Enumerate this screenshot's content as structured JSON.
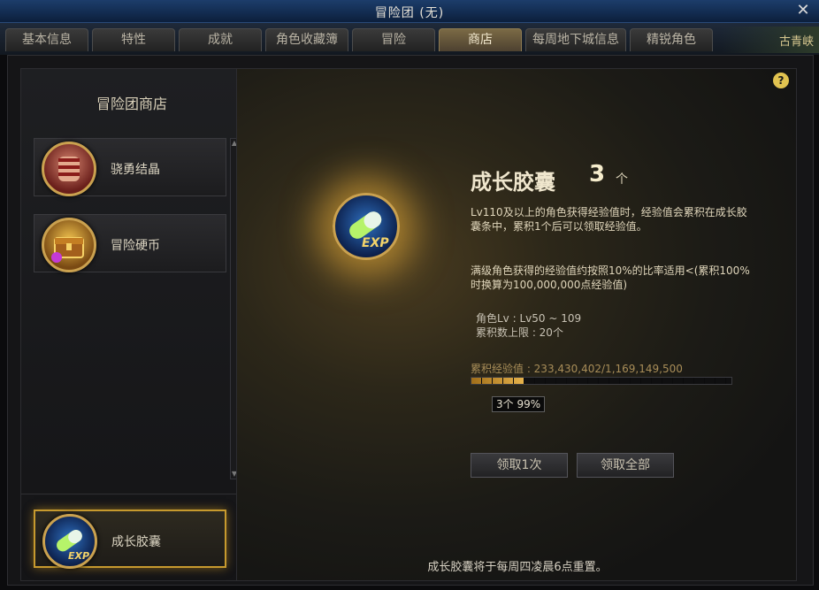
{
  "window": {
    "title": "冒险团 (无)",
    "close_icon": "close-icon"
  },
  "tabs": [
    {
      "label": "基本信息",
      "active": false
    },
    {
      "label": "特性",
      "active": false
    },
    {
      "label": "成就",
      "active": false
    },
    {
      "label": "角色收藏簿",
      "active": false
    },
    {
      "label": "冒险",
      "active": false
    },
    {
      "label": "商店",
      "active": true
    },
    {
      "label": "每周地下城信息",
      "active": false
    },
    {
      "label": "精锐角色",
      "active": false
    }
  ],
  "tab_deco_text": "古青峡",
  "sidebar": {
    "title": "冒险团商店",
    "items": [
      {
        "label": "骁勇结晶",
        "icon": "fist-crystal-icon"
      },
      {
        "label": "冒险硬币",
        "icon": "treasure-chest-icon"
      }
    ],
    "selected": {
      "label": "成长胶囊",
      "icon": "exp-capsule-icon"
    }
  },
  "detail": {
    "name": "成长胶囊",
    "count": "3",
    "unit": "个",
    "desc1": "Lv110及以上的角色获得经验值时，经验值会累积在成长胶囊条中，累积1个后可以领取经验值。",
    "desc2": "满级角色获得的经验值约按照10%的比率适用<(累积100%时换算为100,000,000点经验值)",
    "stat_level": "角色Lv : Lv50 ~ 109",
    "stat_limit": "累积数上限 : 20个",
    "exp_label": "累积经验值 : 233,430,402/1,169,149,500",
    "exp_progress": 0.1997,
    "tooltip": "3个 99%",
    "btn_claim_one": "领取1次",
    "btn_claim_all": "领取全部",
    "footer": "成长胶囊将于每周四凌晨6点重置。"
  },
  "help_icon": "?"
}
